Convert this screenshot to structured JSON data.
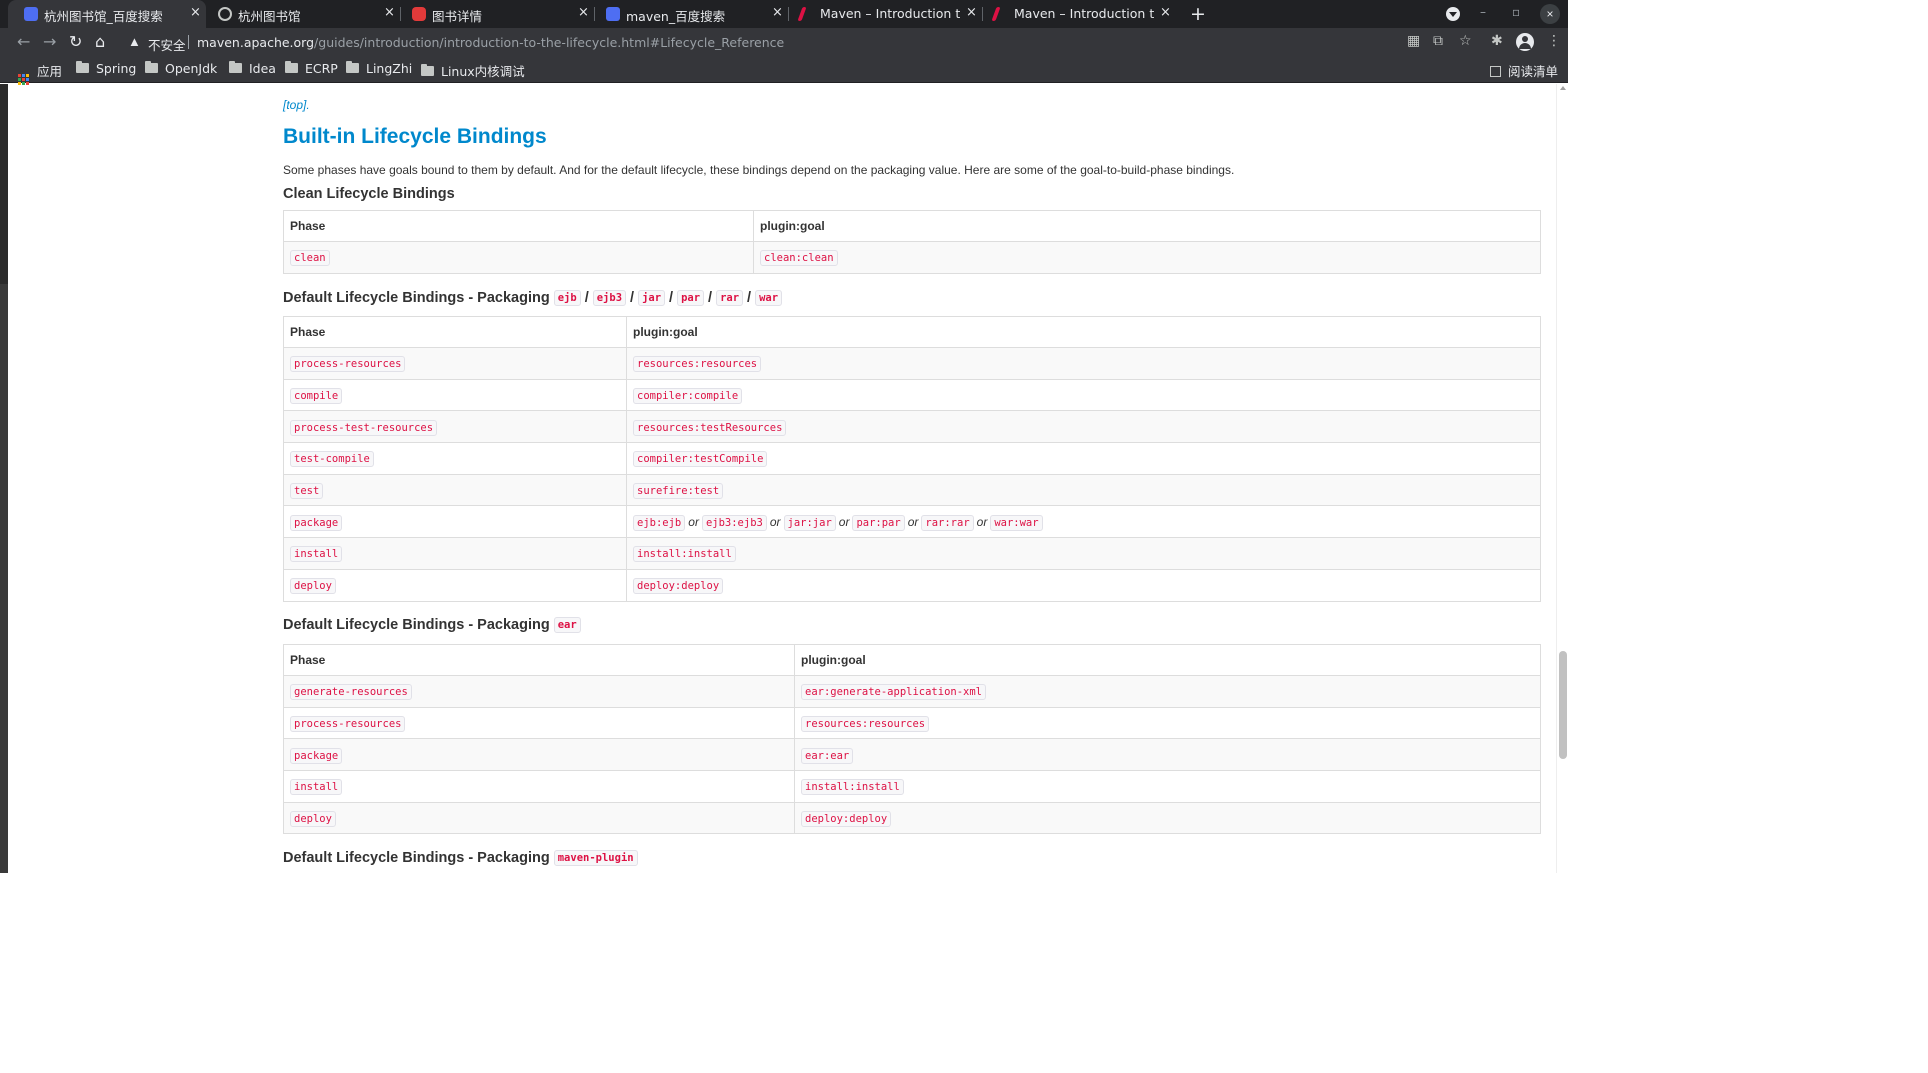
{
  "browser": {
    "tabs": [
      {
        "title": "杭州图书馆_百度搜索",
        "active": true
      },
      {
        "title": "杭州图书馆",
        "active": false
      },
      {
        "title": "图书详情",
        "active": false
      },
      {
        "title": "maven_百度搜索",
        "active": false
      },
      {
        "title": "Maven – Introduction to t",
        "active": false
      },
      {
        "title": "Maven – Introduction to t",
        "active": false
      }
    ],
    "new_tab": "+",
    "close_glyph": "×",
    "security_label": "不安全",
    "url_host": "maven.apache.org",
    "url_path": "/guides/introduction/introduction-to-the-lifecycle.html#Lifecycle_Reference",
    "bookmarks": [
      "应用",
      "Spring",
      "OpenJdk",
      "Idea",
      "ECRP",
      "LingZhi",
      "Linux内核调试"
    ],
    "reading_list": "阅读清单"
  },
  "page": {
    "top_link": "[top].",
    "section_title": "Built-in Lifecycle Bindings",
    "intro": "Some phases have goals bound to them by default. And for the default lifecycle, these bindings depend on the packaging value. Here are some of the goal-to-build-phase bindings.",
    "or_word": "or",
    "clean": {
      "heading": "Clean Lifecycle Bindings",
      "headers": [
        "Phase",
        "plugin:goal"
      ],
      "rows": [
        [
          "clean",
          "clean:clean"
        ]
      ]
    },
    "jar": {
      "heading": "Default Lifecycle Bindings - Packaging",
      "packagings": [
        "ejb",
        "ejb3",
        "jar",
        "par",
        "rar",
        "war"
      ],
      "separator": "/",
      "headers": [
        "Phase",
        "plugin:goal"
      ],
      "rows": [
        [
          "process-resources",
          "resources:resources"
        ],
        [
          "compile",
          "compiler:compile"
        ],
        [
          "process-test-resources",
          "resources:testResources"
        ],
        [
          "test-compile",
          "compiler:testCompile"
        ],
        [
          "test",
          "surefire:test"
        ],
        [
          "package",
          "ejb:ejb"
        ],
        [
          "install",
          "install:install"
        ],
        [
          "deploy",
          "deploy:deploy"
        ]
      ],
      "package_goals": [
        "ejb:ejb",
        "ejb3:ejb3",
        "jar:jar",
        "par:par",
        "rar:rar",
        "war:war"
      ]
    },
    "ear": {
      "heading": "Default Lifecycle Bindings - Packaging",
      "packaging": "ear",
      "headers": [
        "Phase",
        "plugin:goal"
      ],
      "rows": [
        [
          "generate-resources",
          "ear:generate-application-xml"
        ],
        [
          "process-resources",
          "resources:resources"
        ],
        [
          "package",
          "ear:ear"
        ],
        [
          "install",
          "install:install"
        ],
        [
          "deploy",
          "deploy:deploy"
        ]
      ]
    },
    "maven_plugin": {
      "heading": "Default Lifecycle Bindings - Packaging",
      "packaging": "maven-plugin"
    }
  }
}
